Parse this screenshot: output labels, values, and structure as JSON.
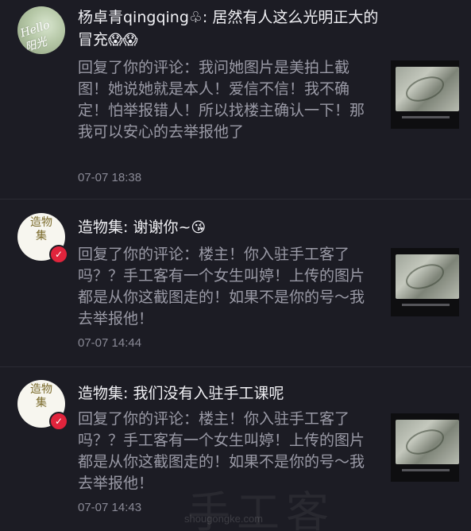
{
  "comments": [
    {
      "avatar_text": "Hello 阳光",
      "header": "杨卓青qingqing♧: 居然有人这么光明正大的冒充",
      "header_emoji": "😱😱",
      "reply": "回复了你的评论：我问她图片是美拍上截图！她说她就是本人！爱信不信！我不确定！怕举报错人！所以找楼主确认一下！那我可以安心的去举报他了",
      "time": "07-07 18:38"
    },
    {
      "avatar_text": "造物集",
      "badge": "✓",
      "header": "造物集: 谢谢你~",
      "header_emoji": "😘",
      "reply": "回复了你的评论：楼主！你入驻手工客了吗？？手工客有一个女生叫婷！上传的图片都是从你这截图走的！如果不是你的号～我去举报他！",
      "time": "07-07 14:44"
    },
    {
      "avatar_text": "造物集",
      "badge": "✓",
      "header": "造物集: 我们没有入驻手工课呢",
      "header_emoji": "",
      "reply": "回复了你的评论：楼主！你入驻手工客了吗？？手工客有一个女生叫婷！上传的图片都是从你这截图走的！如果不是你的号～我去举报他！",
      "time": "07-07 14:43"
    }
  ],
  "watermark": {
    "text": "手工客",
    "url": "shougongke.com"
  },
  "colors": {
    "background": "#1c1c24",
    "badge": "#e0243c",
    "reply_text": "#9a9aa6"
  }
}
